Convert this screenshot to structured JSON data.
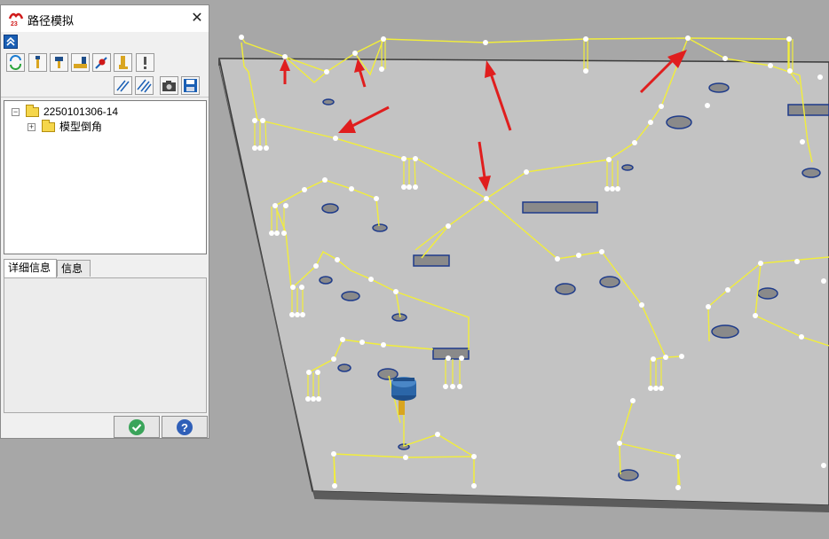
{
  "window": {
    "title": "路径模拟"
  },
  "tree": {
    "root_label": "2250101306-14",
    "child_label": "模型倒角"
  },
  "tabs": [
    "详细信息",
    "信息"
  ],
  "colors": {
    "toolpath": "#f2ee3a",
    "plate": "#c3c3c3",
    "arrow": "#e01e1e",
    "accent": "#1a5fb4",
    "ok_green": "#3aa45a",
    "help_blue": "#2f5fb8"
  },
  "icons": {
    "logo": "app-logo-icon",
    "close": "close-icon",
    "collapse": "collapse-up-icon",
    "confirm": "check-icon",
    "help": "question-icon"
  }
}
